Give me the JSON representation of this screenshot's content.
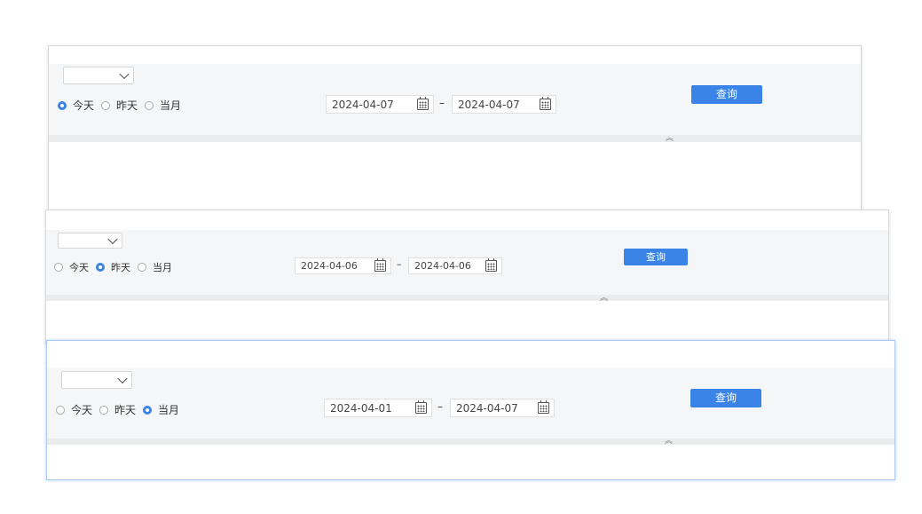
{
  "panels": [
    {
      "select_value": "",
      "radios": [
        {
          "label": "今天",
          "checked": true
        },
        {
          "label": "昨天",
          "checked": false
        },
        {
          "label": "当月",
          "checked": false
        }
      ],
      "date_start": "2024-04-07",
      "date_end": "2024-04-07",
      "range_separator": "–",
      "query_label": "查询",
      "collapse_glyph": "︽"
    },
    {
      "select_value": "",
      "radios": [
        {
          "label": "今天",
          "checked": false
        },
        {
          "label": "昨天",
          "checked": true
        },
        {
          "label": "当月",
          "checked": false
        }
      ],
      "date_start": "2024-04-06",
      "date_end": "2024-04-06",
      "range_separator": "–",
      "query_label": "查询",
      "collapse_glyph": "︽"
    },
    {
      "select_value": "",
      "radios": [
        {
          "label": "今天",
          "checked": false
        },
        {
          "label": "昨天",
          "checked": false
        },
        {
          "label": "当月",
          "checked": true
        }
      ],
      "date_start": "2024-04-01",
      "date_end": "2024-04-07",
      "range_separator": "–",
      "query_label": "查询",
      "collapse_glyph": "︽"
    }
  ],
  "colors": {
    "accent": "#3a84e8",
    "bar_bg": "#f5f6f7",
    "focus_border": "#a9c8f0"
  }
}
